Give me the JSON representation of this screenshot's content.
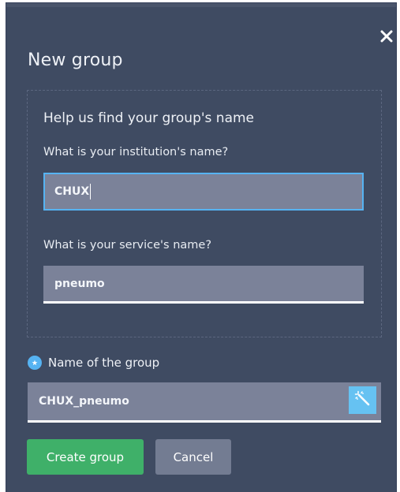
{
  "dialog": {
    "title": "New group",
    "close_icon": "close-icon"
  },
  "helper": {
    "heading": "Help us find your group's name",
    "institution": {
      "label": "What is your institution's name?",
      "value": "CHUX"
    },
    "service": {
      "label": "What is your service's name?",
      "value": "pneumo"
    }
  },
  "group": {
    "info_icon": "info-icon",
    "label": "Name of the group",
    "value": "CHUX_pneumo",
    "generate_icon": "magic-wand-icon"
  },
  "actions": {
    "create_label": "Create group",
    "cancel_label": "Cancel"
  },
  "colors": {
    "background": "#3f4b62",
    "field": "#7b8299",
    "focus_border": "#56b3f2",
    "primary": "#3fb069",
    "secondary": "#737c92",
    "accent": "#66c2f2"
  }
}
